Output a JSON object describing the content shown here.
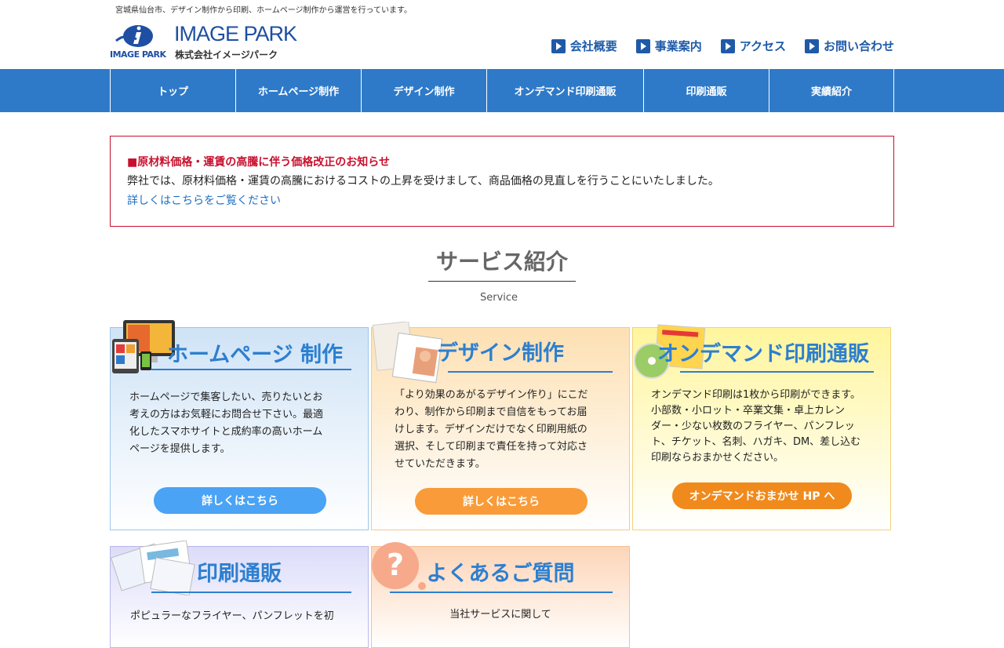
{
  "header": {
    "tagline": "宮城県仙台市、デザイン制作から印刷、ホームページ制作から運営を行っています。",
    "logo_name": "IMAGE PARK",
    "logo_sub": "IMAGE PARK",
    "company": "株式会社イメージパーク",
    "topnav": [
      {
        "label": "会社概要"
      },
      {
        "label": "事業案内"
      },
      {
        "label": "アクセス"
      },
      {
        "label": "お問い合わせ"
      }
    ]
  },
  "mainnav": [
    {
      "label": "トップ"
    },
    {
      "label": "ホームページ制作"
    },
    {
      "label": "デザイン制作"
    },
    {
      "label": "オンデマンド印刷通販"
    },
    {
      "label": "印刷通販"
    },
    {
      "label": "実績紹介"
    }
  ],
  "notice": {
    "title": "■原材料価格・運賃の高騰に伴う価格改正のお知らせ",
    "text": "弊社では、原材料価格・運賃の高騰におけるコストの上昇を受けまして、商品価格の見直しを行うことにいたしました。",
    "link": "詳しくはこちらをご覧ください"
  },
  "service": {
    "title": "サービス紹介",
    "subtitle": "Service",
    "cards": [
      {
        "title": "ホームページ 制作",
        "lines": [
          "ホームページで集客したい、売りたいとお",
          "考えの方はお気軽にお問合せ下さい。最適",
          "化したスマホサイトと成約率の高いホーム",
          "ページを提供します。"
        ],
        "button": "詳しくはこちら"
      },
      {
        "title": "デザイン制作",
        "lines": [
          "「より効果のあがるデザイン作り」にこだ",
          "わり、制作から印刷まで自信をもってお届",
          "けします。デザインだけでなく印刷用紙の",
          "選択、そして印刷まで責任を持って対応さ",
          "せていただきます。"
        ],
        "button": "詳しくはこちら"
      },
      {
        "title": "オンデマンド印刷通販",
        "lines": [
          "オンデマンド印刷は1枚から印刷ができます。",
          "小部数・小ロット・卒業文集・卓上カレン",
          "ダー・少ない枚数のフライヤー、パンフレッ",
          "ト、チケット、名刺、ハガキ、DM、差し込む",
          "印刷ならおまかせください。"
        ],
        "button": "オンデマンドおまかせ HP へ"
      },
      {
        "title": "印刷通販",
        "lines": [
          "ポピュラーなフライヤー、パンフレットを初"
        ]
      },
      {
        "title": "よくあるご質問",
        "lines": [
          "当社サービスに関して"
        ]
      }
    ]
  },
  "colors": {
    "brand_blue": "#2e7ac9",
    "notice_red": "#c8102e",
    "btn_blue": "#4aa3f5",
    "btn_orange": "#f99b38",
    "btn_dark_orange": "#f08a1c"
  }
}
